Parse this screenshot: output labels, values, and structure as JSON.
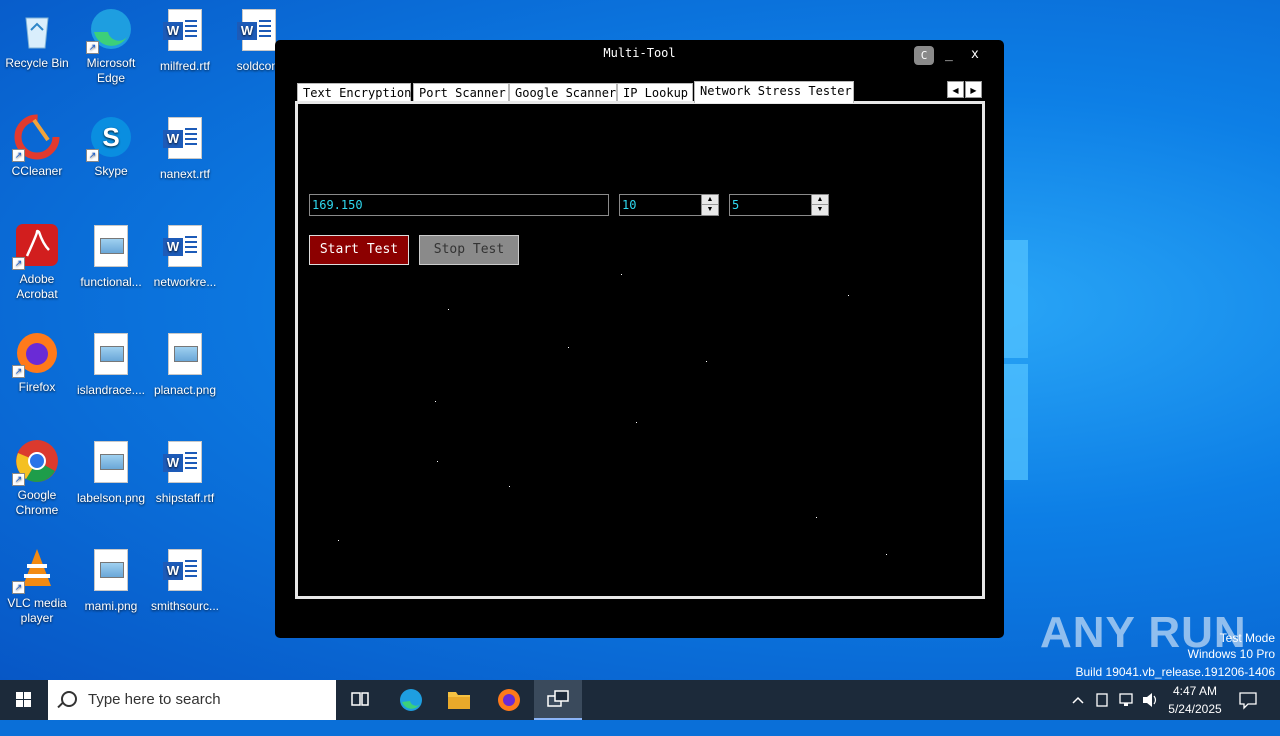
{
  "desktop": {
    "icons": [
      {
        "label": "Recycle Bin",
        "icon": "recycle-bin-icon"
      },
      {
        "label": "Microsoft Edge",
        "icon": "edge-icon"
      },
      {
        "label": "milfred.rtf",
        "icon": "word-doc-icon"
      },
      {
        "label": "soldcom",
        "icon": "word-doc-icon"
      },
      {
        "label": "CCleaner",
        "icon": "ccleaner-icon"
      },
      {
        "label": "Skype",
        "icon": "skype-icon"
      },
      {
        "label": "nanext.rtf",
        "icon": "word-doc-icon"
      },
      {
        "label": "Adobe Acrobat",
        "icon": "acrobat-icon"
      },
      {
        "label": "functional...",
        "icon": "image-file-icon"
      },
      {
        "label": "networkre...",
        "icon": "word-doc-icon"
      },
      {
        "label": "Firefox",
        "icon": "firefox-icon"
      },
      {
        "label": "islandrace....",
        "icon": "image-file-icon"
      },
      {
        "label": "planact.png",
        "icon": "image-file-icon"
      },
      {
        "label": "Google Chrome",
        "icon": "chrome-icon"
      },
      {
        "label": "labelson.png",
        "icon": "image-file-icon"
      },
      {
        "label": "shipstaff.rtf",
        "icon": "word-doc-icon"
      },
      {
        "label": "VLC media player",
        "icon": "vlc-icon"
      },
      {
        "label": "mami.png",
        "icon": "image-file-icon"
      },
      {
        "label": "smithsourc...",
        "icon": "word-doc-icon"
      }
    ]
  },
  "app": {
    "title": "Multi-Tool",
    "theme_label": "C",
    "minimize_label": "_",
    "close_label": "X",
    "tabs": [
      {
        "label": "Text Encryption"
      },
      {
        "label": "Port Scanner"
      },
      {
        "label": "Google Scanner"
      },
      {
        "label": "IP Lookup"
      },
      {
        "label": "Network Stress Tester",
        "active": true
      }
    ],
    "scroll_left": "◀",
    "scroll_right": "▶",
    "stress_tester": {
      "ip_value": "169.150",
      "threads_value": "10",
      "duration_value": "5",
      "start_label": "Start Test",
      "stop_label": "Stop Test"
    }
  },
  "watermark": {
    "brand": "ANY RUN",
    "mode": "Test Mode",
    "edition": "Windows 10 Pro",
    "build": "Build 19041.vb_release.191206-1406"
  },
  "taskbar": {
    "search_placeholder": "Type here to search",
    "time": "4:47 AM",
    "date": "5/24/2025"
  },
  "colors": {
    "accent_start": "#8c0000",
    "input_text": "#2fd9f0",
    "desktop_blue": "#0d7fe6"
  }
}
